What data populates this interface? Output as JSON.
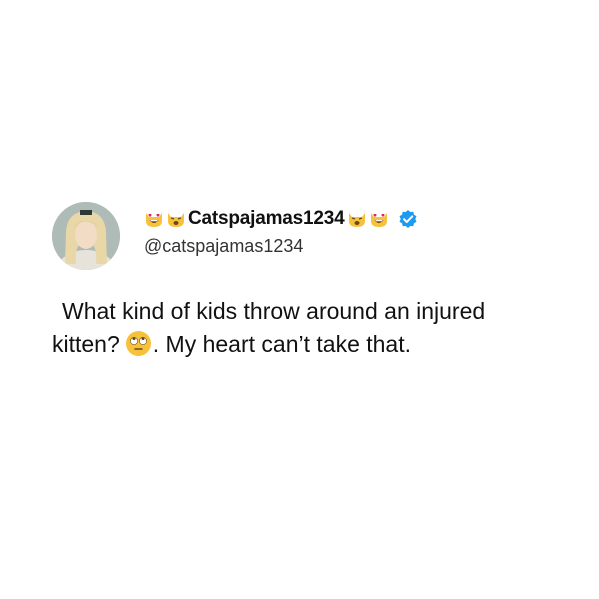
{
  "tweet": {
    "display_name": "Catspajamas1234",
    "handle": "@catspajamas1234",
    "verified": true,
    "name_emojis_before": [
      "smiling-cat-heart-eyes",
      "weary-cat"
    ],
    "name_emojis_after": [
      "weary-cat",
      "smiling-cat-heart-eyes"
    ],
    "text_part1": "What kind of kids throw around an injured kitten?",
    "text_emoji": "face-with-rolling-eyes",
    "text_part2": ". My heart can’t take that."
  },
  "colors": {
    "verified_badge": "#1d9bf0",
    "emoji_yellow": "#f7c23b",
    "heart_red": "#e0245e"
  }
}
